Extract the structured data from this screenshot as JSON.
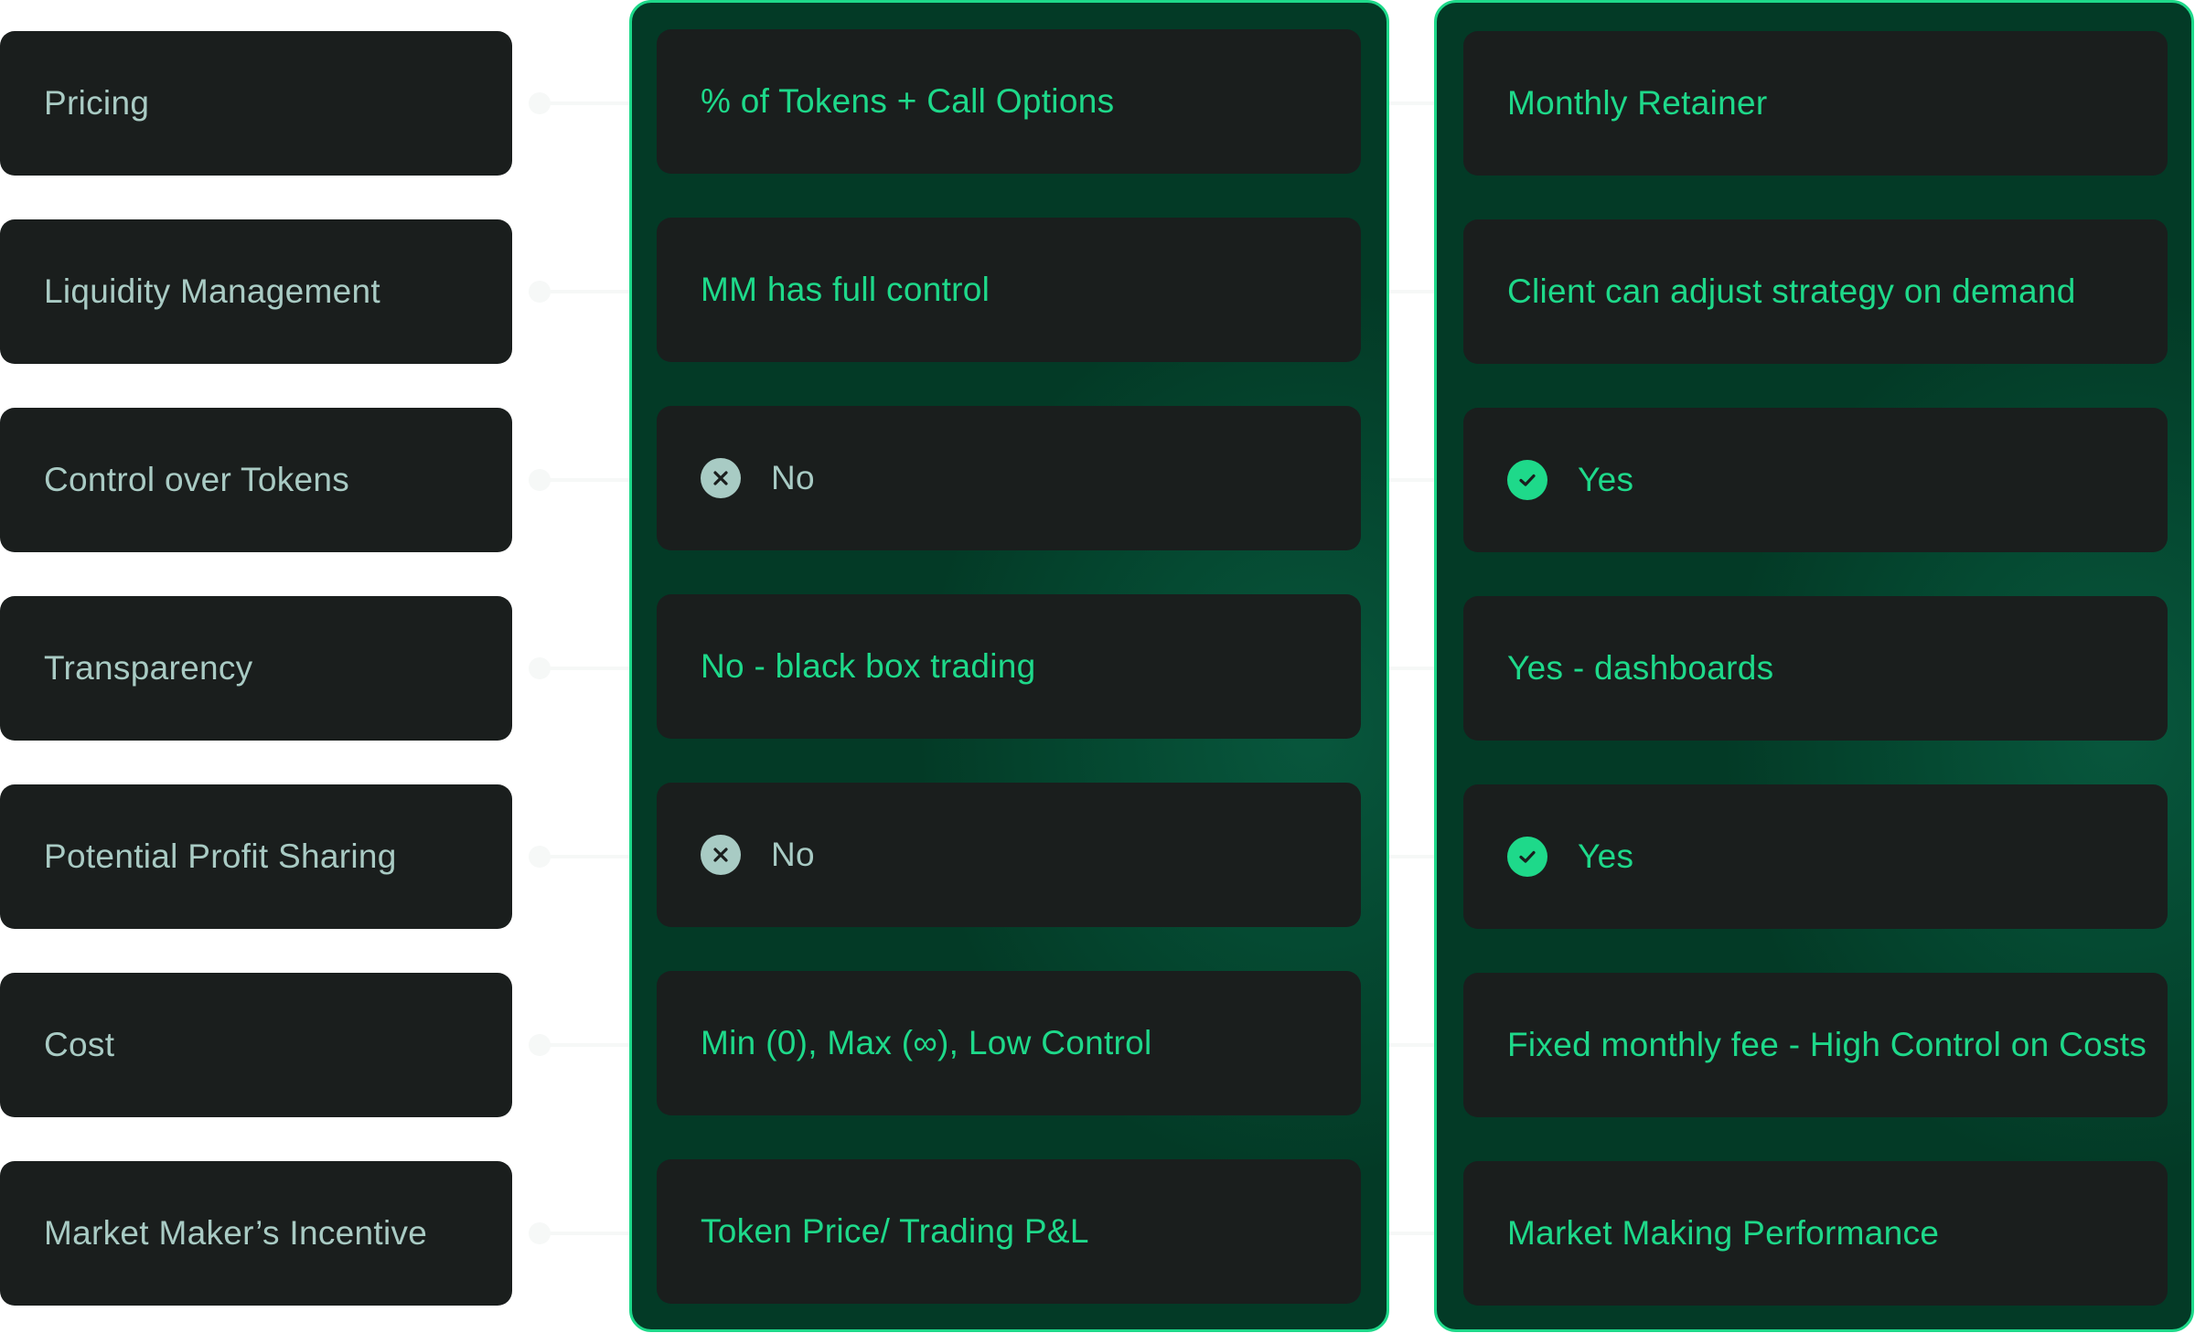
{
  "colors": {
    "accent": "#1ed98a",
    "label_text": "#a9cbc4",
    "card_bg": "#1a1e1d",
    "panel_bg": "#033a26",
    "icon_muted": "#a8cbc4"
  },
  "rows": [
    {
      "label": "Pricing"
    },
    {
      "label": "Liquidity Management"
    },
    {
      "label": "Control over Tokens"
    },
    {
      "label": "Transparency"
    },
    {
      "label": "Potential Profit Sharing"
    },
    {
      "label": "Cost"
    },
    {
      "label": "Market Maker’s Incentive"
    }
  ],
  "columns": [
    {
      "name": "traditional",
      "values": [
        {
          "text": "% of Tokens + Call Options",
          "icon": null
        },
        {
          "text": "MM has full control",
          "icon": null
        },
        {
          "text": "No",
          "icon": "x-circle-icon"
        },
        {
          "text": "No - black box trading",
          "icon": null
        },
        {
          "text": "No",
          "icon": "x-circle-icon"
        },
        {
          "text": "Min (0), Max (∞), Low Control",
          "icon": null
        },
        {
          "text": "Token Price/ Trading P&L",
          "icon": null
        }
      ]
    },
    {
      "name": "retainer",
      "values": [
        {
          "text": "Monthly Retainer",
          "icon": null
        },
        {
          "text": "Client can adjust strategy on demand",
          "icon": null
        },
        {
          "text": "Yes",
          "icon": "check-circle-icon"
        },
        {
          "text": "Yes - dashboards",
          "icon": null
        },
        {
          "text": "Yes",
          "icon": "check-circle-icon"
        },
        {
          "text": "Fixed monthly fee - High Control on Costs",
          "icon": null
        },
        {
          "text": "Market Making Performance",
          "icon": null
        }
      ]
    }
  ]
}
